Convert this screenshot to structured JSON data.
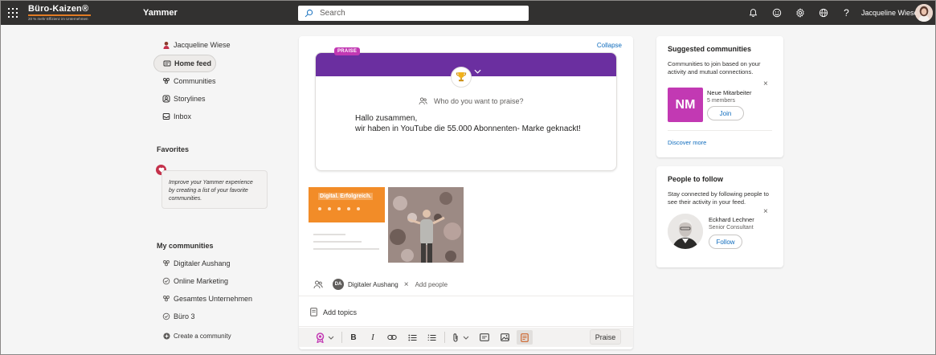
{
  "topbar": {
    "brand_name": "Büro-Kaizen®",
    "brand_tagline": "20 % mehr Effizienz im Unternehmen",
    "app_name": "Yammer",
    "search_placeholder": "Search",
    "user_name": "Jacqueline Wiese",
    "icons": [
      "bell-icon",
      "smiley-icon",
      "gear-icon",
      "globe-icon",
      "help-icon"
    ],
    "help_glyph": "?"
  },
  "nav": {
    "items": [
      {
        "label": "Jacqueline Wiese",
        "icon": "user-avatar-icon"
      },
      {
        "label": "Home feed",
        "icon": "feed-icon",
        "active": true
      },
      {
        "label": "Communities",
        "icon": "communities-icon"
      },
      {
        "label": "Storylines",
        "icon": "storylines-icon"
      },
      {
        "label": "Inbox",
        "icon": "inbox-icon"
      }
    ],
    "favorites_title": "Favorites",
    "favorites_hint": "Improve your Yammer experience by creating a list of your favorite communities.",
    "my_communities_title": "My communities",
    "communities": [
      {
        "label": "Digitaler Aushang",
        "icon": "community-icon"
      },
      {
        "label": "Online Marketing",
        "icon": "check-circle-icon"
      },
      {
        "label": "Gesamtes Unternehmen",
        "icon": "community-icon"
      },
      {
        "label": "Büro 3",
        "icon": "check-circle-icon"
      }
    ],
    "create_label": "Create a community"
  },
  "composer": {
    "collapse_label": "Collapse",
    "praise_badge": "PRAISE",
    "who_placeholder": "Who do you want to praise?",
    "message_line1": "Hallo zusammen,",
    "message_line2": "wir haben in YouTube die 55.000 Abonnenten- Marke geknackt!",
    "thumb1_label": "Digital. Erfolgreich.",
    "chip_initials": "DA",
    "chip_label": "Digitaler Aushang",
    "remove_glyph": "×",
    "add_people": "Add people",
    "add_topics": "Add topics",
    "toolbar": {
      "bold": "B",
      "italic": "I",
      "praise_button": "Praise"
    }
  },
  "suggested": {
    "title": "Suggested communities",
    "description": "Communities to join based on your activity and mutual connections.",
    "community_initials": "NM",
    "community_name": "Neue Mitarbeiter",
    "community_members": "5 members",
    "join_label": "Join",
    "discover_more": "Discover more",
    "close_glyph": "×",
    "tile_color": "#c239b3"
  },
  "people": {
    "title": "People to follow",
    "description": "Stay connected by following people to see their activity in your feed.",
    "person_name": "Eckhard Lechner",
    "person_role": "Senior Consultant",
    "follow_label": "Follow",
    "close_glyph": "×"
  },
  "colors": {
    "topbar": "#323130",
    "accent": "#0f6cbd",
    "praise_band": "#6b2fa0",
    "brand_orange": "#e07b24"
  }
}
